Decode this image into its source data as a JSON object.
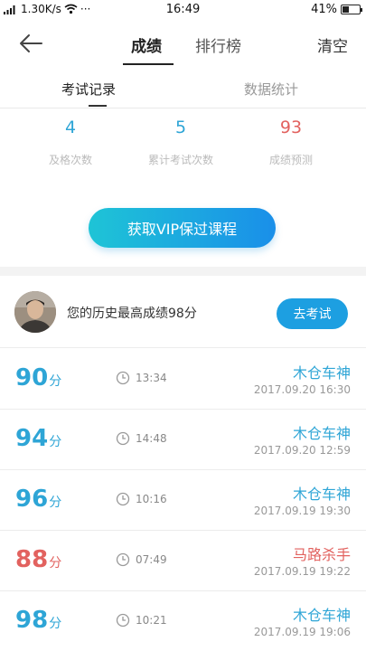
{
  "status_bar": {
    "speed": "1.30K/s",
    "dots": "···",
    "time": "16:49",
    "battery": "41%",
    "battery_level": 0.41
  },
  "nav": {
    "tab_score": "成绩",
    "tab_rank": "排行榜",
    "clear": "清空"
  },
  "subtabs": {
    "records": "考试记录",
    "stats": "数据统计"
  },
  "stats": [
    {
      "value": "4",
      "label": "及格次数",
      "color": "#2ea5d6"
    },
    {
      "value": "5",
      "label": "累计考试次数",
      "color": "#2ea5d6"
    },
    {
      "value": "93",
      "label": "成绩预测",
      "color": "#e2625f"
    }
  ],
  "vip_button": "获取VIP保过课程",
  "best": {
    "text": "您的历史最高成绩98分",
    "button": "去考试"
  },
  "records": [
    {
      "score": "90",
      "unit": "分",
      "duration": "13:34",
      "title": "木仓车神",
      "date": "2017.09.20  16:30",
      "color": "blue"
    },
    {
      "score": "94",
      "unit": "分",
      "duration": "14:48",
      "title": "木仓车神",
      "date": "2017.09.20  12:59",
      "color": "blue"
    },
    {
      "score": "96",
      "unit": "分",
      "duration": "10:16",
      "title": "木仓车神",
      "date": "2017.09.19  19:30",
      "color": "blue"
    },
    {
      "score": "88",
      "unit": "分",
      "duration": "07:49",
      "title": "马路杀手",
      "date": "2017.09.19  19:22",
      "color": "red"
    },
    {
      "score": "98",
      "unit": "分",
      "duration": "10:21",
      "title": "木仓车神",
      "date": "2017.09.19  19:06",
      "color": "blue"
    }
  ]
}
